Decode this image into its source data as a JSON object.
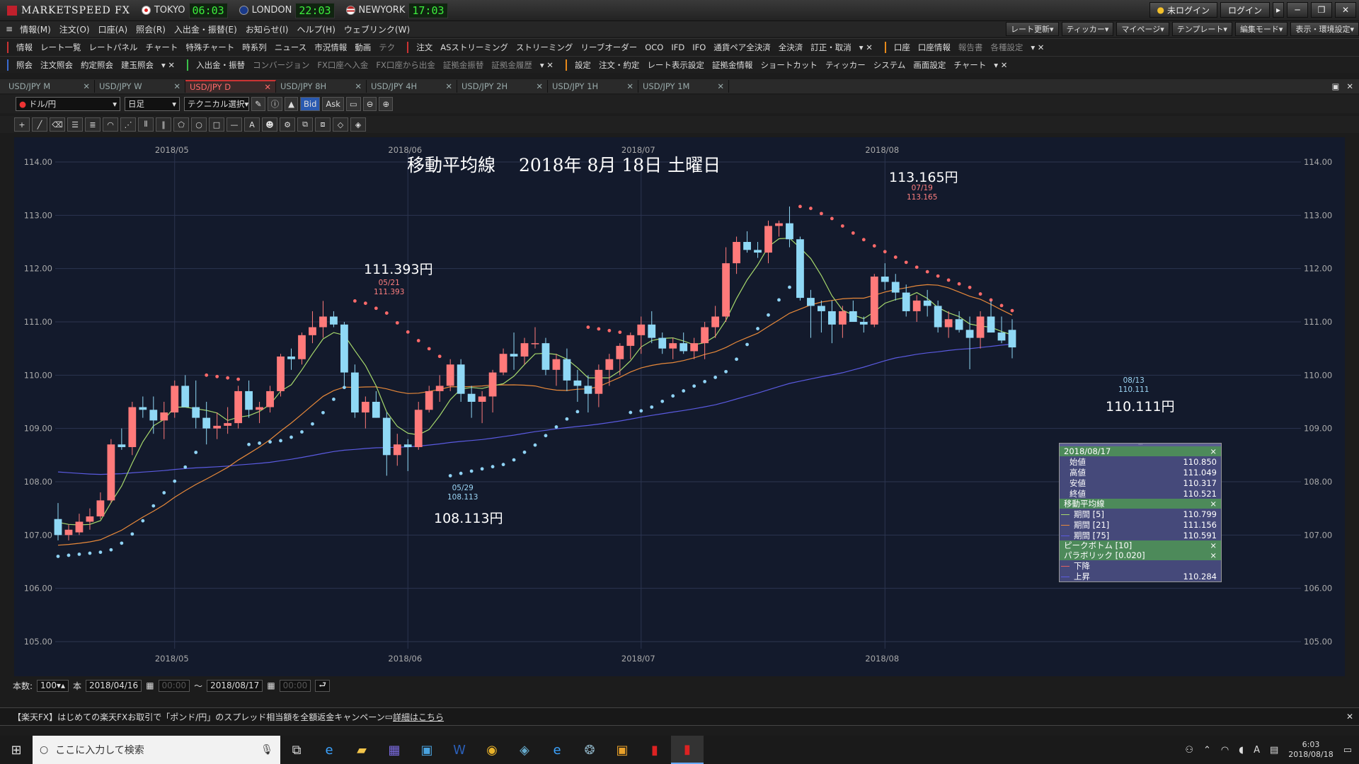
{
  "titlebar": {
    "app": "MARKETSPEED FX",
    "clocks": [
      {
        "city": "TOKYO",
        "time": "06:03"
      },
      {
        "city": "LONDON",
        "time": "22:03"
      },
      {
        "city": "NEWYORK",
        "time": "17:03"
      }
    ],
    "status": "未ログイン",
    "login": "ログイン"
  },
  "menu": {
    "items": [
      "情報(M)",
      "注文(O)",
      "口座(A)",
      "照会(R)",
      "入出金・振替(E)",
      "お知らせ(I)",
      "ヘルプ(H)",
      "ウェブリンク(W)"
    ],
    "right": [
      "レート更新▾",
      "ティッカー▾",
      "マイページ▾",
      "テンプレート▾",
      "編集モード▾",
      "表示・環境設定▾"
    ]
  },
  "toolbar1": {
    "info": [
      "情報",
      "レート一覧",
      "レートパネル",
      "チャート",
      "特殊チャート",
      "時系列",
      "ニュース",
      "市況情報",
      "動画",
      "テク"
    ],
    "order": [
      "注文",
      "ASストリーミング",
      "ストリーミング",
      "リーブオーダー",
      "OCO",
      "IFD",
      "IFO",
      "通貨ペア全決済",
      "全決済",
      "訂正・取消"
    ],
    "account": [
      "口座",
      "口座情報",
      "報告書",
      "各種設定"
    ]
  },
  "toolbar2": {
    "inquiry": [
      "照会",
      "注文照会",
      "約定照会",
      "建玉照会"
    ],
    "transfer": [
      "入出金・振替",
      "コンバージョン",
      "FX口座へ入金",
      "FX口座から出金",
      "証拠金振替",
      "証拠金履歴"
    ],
    "settings": [
      "設定",
      "注文・約定",
      "レート表示設定",
      "証拠金情報",
      "ショートカット",
      "ティッカー",
      "システム",
      "画面設定",
      "チャート"
    ]
  },
  "tabs": [
    "USD/JPY M",
    "USD/JPY W",
    "USD/JPY D",
    "USD/JPY 8H",
    "USD/JPY 4H",
    "USD/JPY 2H",
    "USD/JPY 1H",
    "USD/JPY 1M"
  ],
  "active_tab": 2,
  "controls": {
    "pair": "ドル/円",
    "period": "日足",
    "technical": "テクニカル選択",
    "bid": "Bid",
    "ask": "Ask"
  },
  "chart_title": "移動平均線　 2018年 8月 18日 土曜日",
  "annotations": {
    "high1": {
      "big": "111.393円",
      "date": "05/21",
      "val": "111.393"
    },
    "low1": {
      "big": "108.113円",
      "date": "05/29",
      "val": "108.113"
    },
    "high2": {
      "big": "113.165円",
      "date": "07/19",
      "val": "113.165"
    },
    "low2": {
      "big": "110.111円",
      "date": "08/13",
      "val": "110.111"
    }
  },
  "legend": {
    "date": "2018/08/17",
    "ohlc": [
      {
        "k": "始値",
        "v": "110.850"
      },
      {
        "k": "高値",
        "v": "111.049"
      },
      {
        "k": "安値",
        "v": "110.317"
      },
      {
        "k": "終値",
        "v": "110.521"
      }
    ],
    "ma_title": "移動平均線",
    "ma": [
      {
        "k": "期間 [5]",
        "v": "110.799",
        "c": "#a6d86c"
      },
      {
        "k": "期間 [21]",
        "v": "111.156",
        "c": "#e8893a"
      },
      {
        "k": "期間 [75]",
        "v": "110.591",
        "c": "#5a5ae0"
      }
    ],
    "peak": "ピークボトム [10]",
    "sar": "パラボリック [0.020]",
    "sar_rows": [
      {
        "k": "下降",
        "v": "",
        "c": "#e06060"
      },
      {
        "k": "上昇",
        "v": "110.284",
        "c": "#5a5ae0"
      }
    ]
  },
  "bottom": {
    "count_label": "本数:",
    "count": "100",
    "unit": "本",
    "from": "2018/04/16",
    "to": "2018/08/17",
    "time_ph": "00:00",
    "tilde": "〜"
  },
  "news": "【楽天FX】はじめての楽天FXお取引で「ポンド/円」のスプレッド相当額を全額返金キャンペーン",
  "news_link": "詳細はこちら",
  "taskbar": {
    "search": "ここに入力して検索",
    "time": "6:03",
    "date": "2018/08/18"
  },
  "chart_data": {
    "type": "candlestick",
    "y_ticks": [
      "114.00",
      "113.00",
      "112.00",
      "111.00",
      "110.00",
      "109.00",
      "108.00",
      "107.00",
      "106.00",
      "105.00"
    ],
    "ylim": [
      105,
      114
    ],
    "x_labels": [
      "2018/05",
      "2018/06",
      "2018/07",
      "2018/08"
    ],
    "candles": [
      [
        107.3,
        107.6,
        106.9,
        107.0
      ],
      [
        107.0,
        107.2,
        106.9,
        107.1
      ],
      [
        107.05,
        107.4,
        107.0,
        107.25
      ],
      [
        107.25,
        107.5,
        107.1,
        107.35
      ],
      [
        107.35,
        107.8,
        107.3,
        107.65
      ],
      [
        107.65,
        108.8,
        107.6,
        108.7
      ],
      [
        108.7,
        109.0,
        108.6,
        108.65
      ],
      [
        108.65,
        109.5,
        108.5,
        109.4
      ],
      [
        109.4,
        109.6,
        109.2,
        109.35
      ],
      [
        109.35,
        109.6,
        108.9,
        109.15
      ],
      [
        109.15,
        109.5,
        108.8,
        109.3
      ],
      [
        109.3,
        109.9,
        109.2,
        109.8
      ],
      [
        109.8,
        110.0,
        109.5,
        109.4
      ],
      [
        109.4,
        109.9,
        109.0,
        109.2
      ],
      [
        109.2,
        109.5,
        108.7,
        109.0
      ],
      [
        109.0,
        109.3,
        108.8,
        109.05
      ],
      [
        109.05,
        109.4,
        108.9,
        109.1
      ],
      [
        109.1,
        109.8,
        109.0,
        109.7
      ],
      [
        109.7,
        109.9,
        109.2,
        109.35
      ],
      [
        109.35,
        109.5,
        109.1,
        109.4
      ],
      [
        109.4,
        109.8,
        109.3,
        109.7
      ],
      [
        109.7,
        110.4,
        109.6,
        110.35
      ],
      [
        110.35,
        110.5,
        110.1,
        110.3
      ],
      [
        110.3,
        110.8,
        110.2,
        110.75
      ],
      [
        110.75,
        111.2,
        110.6,
        110.9
      ],
      [
        110.9,
        111.393,
        110.7,
        111.1
      ],
      [
        111.1,
        111.2,
        110.9,
        110.95
      ],
      [
        110.95,
        111.0,
        109.8,
        110.05
      ],
      [
        110.05,
        110.2,
        109.2,
        109.3
      ],
      [
        109.3,
        109.6,
        109.0,
        109.5
      ],
      [
        109.5,
        109.7,
        109.2,
        109.2
      ],
      [
        109.2,
        109.3,
        108.113,
        108.5
      ],
      [
        108.5,
        108.9,
        108.3,
        108.7
      ],
      [
        108.7,
        108.8,
        108.2,
        108.65
      ],
      [
        108.65,
        109.5,
        108.6,
        109.35
      ],
      [
        109.35,
        109.8,
        109.3,
        109.7
      ],
      [
        109.7,
        110.0,
        109.5,
        109.8
      ],
      [
        109.8,
        110.3,
        109.7,
        110.2
      ],
      [
        110.2,
        110.3,
        109.5,
        109.65
      ],
      [
        109.65,
        109.8,
        109.2,
        109.5
      ],
      [
        109.5,
        109.7,
        109.1,
        109.6
      ],
      [
        109.6,
        110.1,
        109.3,
        110.05
      ],
      [
        110.05,
        110.5,
        110.0,
        110.4
      ],
      [
        110.4,
        110.8,
        110.1,
        110.35
      ],
      [
        110.35,
        110.7,
        110.2,
        110.6
      ],
      [
        110.6,
        110.9,
        110.5,
        110.6
      ],
      [
        110.6,
        110.7,
        110.0,
        110.1
      ],
      [
        110.1,
        110.4,
        109.8,
        110.3
      ],
      [
        110.3,
        110.5,
        109.7,
        109.9
      ],
      [
        109.9,
        110.1,
        109.5,
        109.8
      ],
      [
        109.8,
        110.0,
        109.3,
        109.65
      ],
      [
        109.65,
        110.2,
        109.4,
        110.1
      ],
      [
        110.1,
        110.4,
        109.8,
        110.3
      ],
      [
        110.3,
        110.6,
        110.0,
        110.55
      ],
      [
        110.55,
        110.8,
        110.3,
        110.75
      ],
      [
        110.75,
        111.1,
        110.4,
        110.95
      ],
      [
        110.95,
        111.2,
        110.6,
        110.7
      ],
      [
        110.7,
        110.8,
        110.4,
        110.5
      ],
      [
        110.5,
        110.7,
        110.3,
        110.6
      ],
      [
        110.6,
        110.8,
        110.4,
        110.45
      ],
      [
        110.45,
        110.7,
        110.3,
        110.6
      ],
      [
        110.6,
        111.0,
        110.3,
        110.9
      ],
      [
        110.9,
        111.3,
        110.7,
        111.1
      ],
      [
        111.1,
        112.4,
        111.0,
        112.1
      ],
      [
        112.1,
        112.6,
        111.9,
        112.5
      ],
      [
        112.5,
        112.7,
        112.3,
        112.35
      ],
      [
        112.35,
        112.5,
        112.2,
        112.3
      ],
      [
        112.3,
        112.9,
        112.1,
        112.8
      ],
      [
        112.8,
        112.9,
        112.6,
        112.85
      ],
      [
        112.85,
        113.165,
        112.4,
        112.55
      ],
      [
        112.55,
        112.6,
        111.4,
        111.45
      ],
      [
        111.45,
        111.6,
        110.7,
        111.3
      ],
      [
        111.3,
        111.4,
        110.8,
        111.2
      ],
      [
        111.2,
        111.4,
        110.6,
        110.95
      ],
      [
        110.95,
        111.3,
        110.7,
        111.2
      ],
      [
        111.2,
        111.4,
        111.0,
        111.0
      ],
      [
        111.0,
        111.1,
        110.8,
        110.95
      ],
      [
        110.95,
        111.9,
        110.9,
        111.85
      ],
      [
        111.85,
        112.1,
        111.6,
        111.75
      ],
      [
        111.75,
        111.9,
        111.4,
        111.55
      ],
      [
        111.55,
        111.7,
        111.1,
        111.2
      ],
      [
        111.2,
        111.5,
        111.0,
        111.4
      ],
      [
        111.4,
        111.6,
        111.1,
        111.3
      ],
      [
        111.3,
        111.4,
        110.8,
        110.9
      ],
      [
        110.9,
        111.2,
        110.7,
        111.05
      ],
      [
        111.05,
        111.2,
        110.8,
        110.85
      ],
      [
        110.85,
        111.1,
        110.111,
        110.7
      ],
      [
        110.7,
        111.2,
        110.5,
        111.1
      ],
      [
        111.1,
        111.4,
        110.8,
        110.8
      ],
      [
        110.8,
        111.1,
        110.6,
        110.65
      ],
      [
        110.85,
        111.049,
        110.317,
        110.521
      ]
    ]
  }
}
